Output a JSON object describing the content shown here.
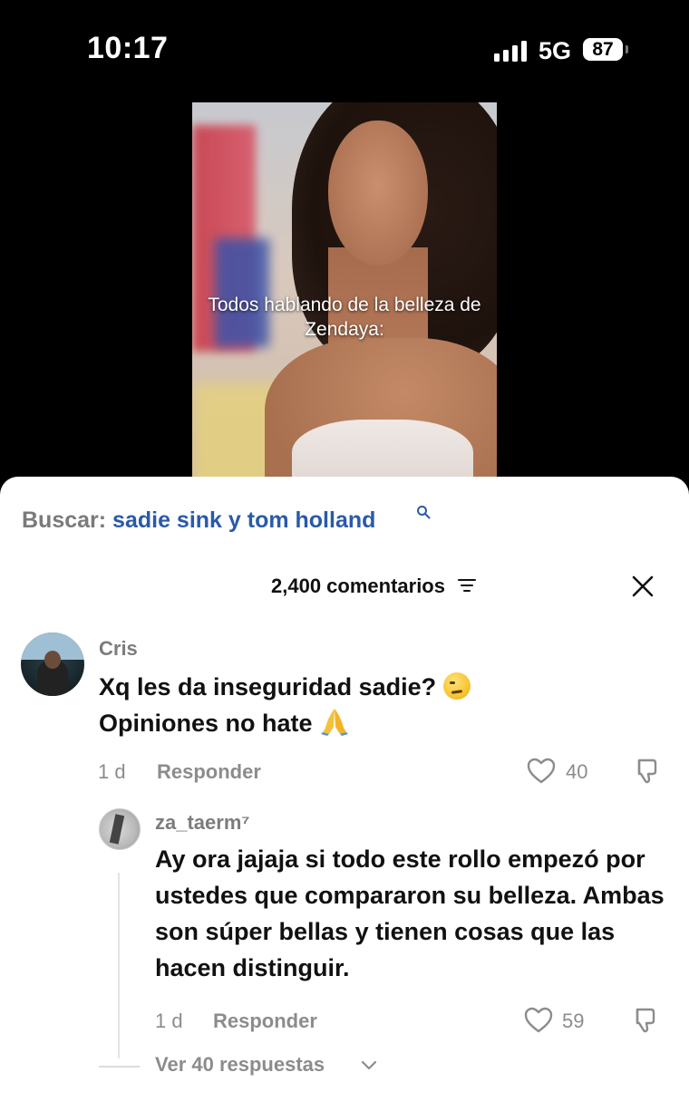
{
  "status_bar": {
    "time": "10:17",
    "network": "5G",
    "battery": "87"
  },
  "video": {
    "caption": "Todos hablando de la belleza de Zendaya:"
  },
  "search": {
    "label": "Buscar:",
    "term": "sadie sink y tom holland"
  },
  "comments_header": {
    "count_label": "2,400 comentarios"
  },
  "comments": [
    {
      "user": "Cris",
      "text_line1": "Xq les da inseguridad sadie?",
      "text_line2": "Opiniones no hate",
      "time": "1 d",
      "reply_label": "Responder",
      "likes": "40"
    },
    {
      "user": "za_taerm⁷",
      "text": "Ay ora jajaja si todo este rollo empezó por ustedes que compararon su belleza. Ambas son súper bellas y tienen cosas que las hacen distinguir.",
      "time": "1 d",
      "reply_label": "Responder",
      "likes": "59"
    }
  ],
  "view_replies": "Ver 40 respuestas",
  "colors": {
    "link": "#2a5aa8",
    "muted": "#8c8c8c",
    "text": "#111111",
    "background_top": "#000000"
  },
  "icons": [
    "search-icon",
    "filter-icon",
    "close-icon",
    "heart-icon",
    "dislike-icon",
    "chevron-down-icon",
    "signal-icon",
    "battery-icon"
  ]
}
